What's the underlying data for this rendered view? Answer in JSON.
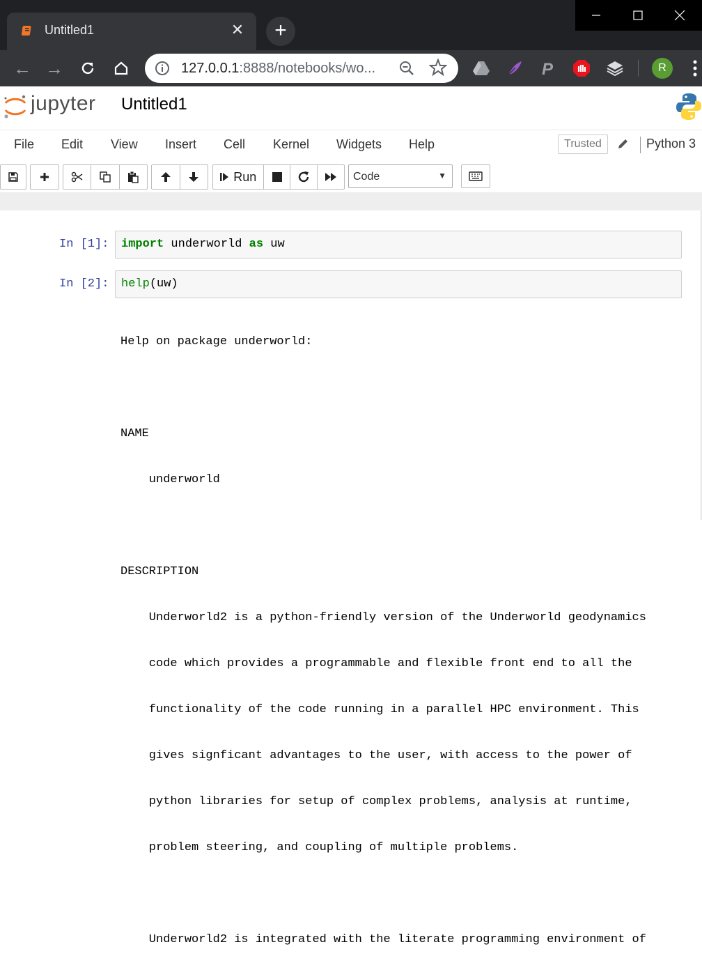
{
  "browser": {
    "tab_title": "Untitled1",
    "url_host": "127.0.0.1",
    "url_rest": ":8888/notebooks/wo...",
    "avatar_letter": "R"
  },
  "jupyter": {
    "logo_text": "jupyter",
    "notebook_title": "Untitled1",
    "menu": [
      "File",
      "Edit",
      "View",
      "Insert",
      "Cell",
      "Kernel",
      "Widgets",
      "Help"
    ],
    "trusted_label": "Trusted",
    "kernel_name": "Python 3",
    "run_label": "Run",
    "cell_type": "Code"
  },
  "cells": [
    {
      "prompt": "In [1]:",
      "tokens": [
        "import",
        " underworld ",
        "as",
        " uw"
      ]
    },
    {
      "prompt": "In [2]:",
      "tokens": [
        "help",
        "(uw)"
      ]
    }
  ],
  "output_lines": [
    "Help on package underworld:",
    "",
    "NAME",
    "    underworld",
    "",
    "DESCRIPTION",
    "    Underworld2 is a python-friendly version of the Underworld geodynamics",
    "    code which provides a programmable and flexible front end to all the",
    "    functionality of the code running in a parallel HPC environment. This",
    "    gives signficant advantages to the user, with access to the power of",
    "    python libraries for setup of complex problems, analysis at runtime,",
    "    problem steering, and coupling of multiple problems.",
    "",
    "    Underworld2 is integrated with the literate programming environment of"
  ]
}
